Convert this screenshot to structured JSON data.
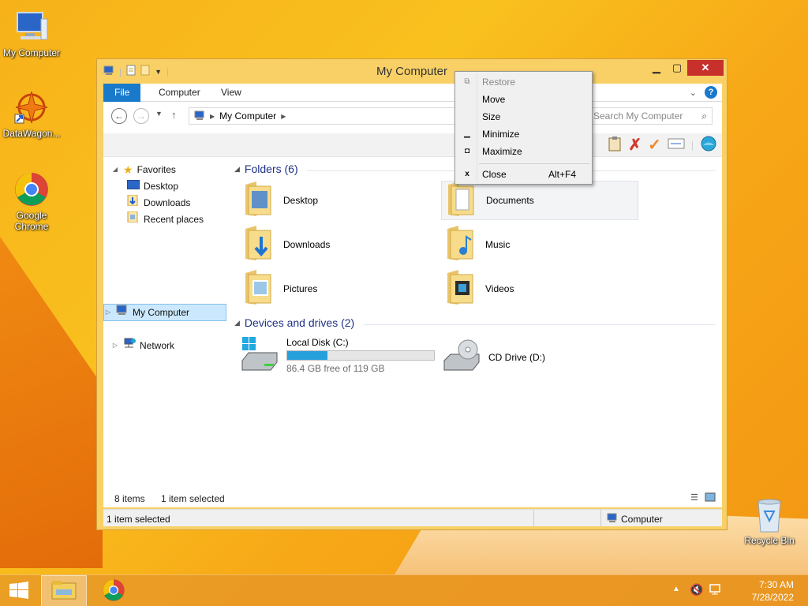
{
  "desktop": {
    "icons": [
      {
        "label": "My Computer",
        "icon": "computer-icon"
      },
      {
        "label": "DataWagon...",
        "icon": "datawagon-icon"
      },
      {
        "label": "Google Chrome",
        "icon": "chrome-icon"
      },
      {
        "label": "Recycle Bin",
        "icon": "recycle-bin-icon"
      }
    ]
  },
  "window": {
    "title": "My Computer",
    "ribbon_tabs": [
      "File",
      "Computer",
      "View"
    ],
    "address": {
      "path": "My Computer"
    },
    "search": {
      "placeholder": "Search My Computer"
    },
    "nav_pane": {
      "favorites": "Favorites",
      "favorites_items": [
        "Desktop",
        "Downloads",
        "Recent places"
      ],
      "my_computer": "My Computer",
      "network": "Network"
    },
    "groups": {
      "folders_title": "Folders (6)",
      "folders": [
        "Desktop",
        "Documents",
        "Downloads",
        "Music",
        "Pictures",
        "Videos"
      ],
      "devices_title": "Devices and drives (2)",
      "drives": [
        {
          "name": "Local Disk (C:)",
          "free_text": "86.4 GB free of 119 GB",
          "used_fraction": 0.274
        },
        {
          "name": "CD Drive (D:)"
        }
      ]
    },
    "status": {
      "items": "8 items",
      "selected": "1 item selected",
      "bottom_left": "1 item selected",
      "bottom_right": "Computer"
    }
  },
  "context_menu": {
    "items": [
      {
        "label": "Restore",
        "icon": "restore-icon",
        "disabled": true
      },
      {
        "label": "Move"
      },
      {
        "label": "Size"
      },
      {
        "label": "Minimize",
        "icon": "minimize-icon"
      },
      {
        "label": "Maximize",
        "icon": "maximize-icon"
      },
      {
        "label": "Close",
        "shortcut": "Alt+F4",
        "icon": "close-icon"
      }
    ]
  },
  "taskbar": {
    "time": "7:30 AM",
    "date": "7/28/2022"
  }
}
